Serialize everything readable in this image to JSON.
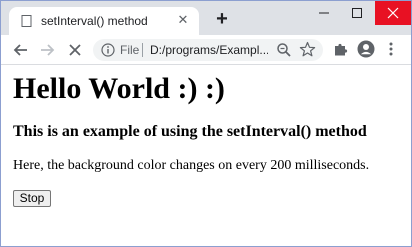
{
  "browser": {
    "tab": {
      "title": "setInterval() method",
      "close_glyph": "✕"
    },
    "new_tab_glyph": "+",
    "omnibox": {
      "scheme_label": "File",
      "url": "D:/programs/Exampl..."
    }
  },
  "page": {
    "heading": "Hello World :) :)",
    "subheading": "This is an example of using the setInterval() method",
    "paragraph": "Here, the background color changes on every 200 milliseconds.",
    "stop_button": "Stop"
  },
  "colors": {
    "tab_strip": "#dee1e6",
    "close_window": "#e81123",
    "omnibox": "#f1f3f4",
    "window_border": "#8c9fd0"
  }
}
